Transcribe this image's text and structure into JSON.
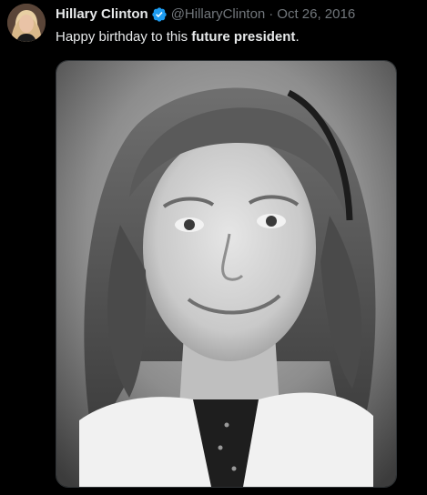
{
  "tweet": {
    "author_name": "Hillary Clinton",
    "verified_icon": "verified-badge-icon",
    "handle": "@HillaryClinton",
    "separator": "·",
    "date": "Oct 26, 2016",
    "text_prefix": "Happy birthday to this ",
    "text_bold": "future president",
    "text_suffix": "."
  },
  "colors": {
    "background": "#000000",
    "primary_text": "#e7e9ea",
    "secondary_text": "#71767b",
    "verified_blue": "#1d9bf0"
  },
  "media": {
    "type": "photo",
    "description_icon": "black-and-white-portrait-photo"
  }
}
